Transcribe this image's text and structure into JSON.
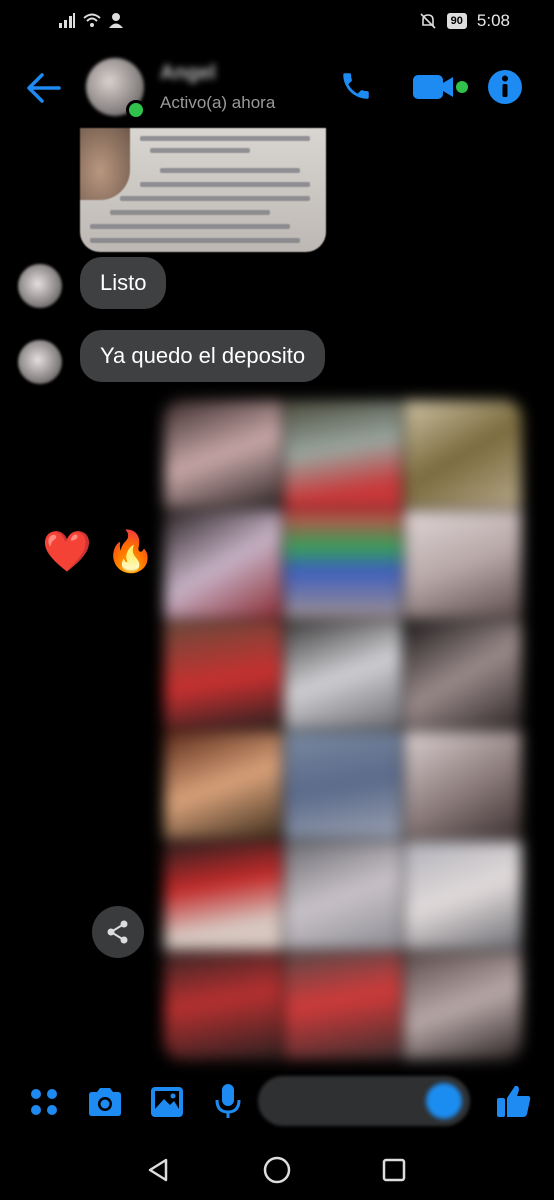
{
  "status_bar": {
    "time": "5:08",
    "battery": "90",
    "icons": [
      "signal-icon",
      "wifi-icon",
      "person-status-icon",
      "mute-bell-icon",
      "battery-icon"
    ]
  },
  "header": {
    "contact_name": "Angel",
    "status": "Activo(a) ahora",
    "accent_color": "#1d8bf1",
    "online_color": "#30c24b"
  },
  "messages": [
    {
      "type": "image",
      "content": "receipt-photo"
    },
    {
      "type": "text",
      "text": "Listo"
    },
    {
      "type": "text",
      "text": "Ya quedo el deposito"
    },
    {
      "type": "image-collage",
      "tile_count": 18
    }
  ],
  "reactions": [
    "❤️",
    "🔥"
  ],
  "composer": {
    "icons": [
      "menu-dots-icon",
      "camera-icon",
      "gallery-icon",
      "microphone-icon",
      "emoji-icon",
      "like-icon"
    ]
  },
  "navbar": {
    "icons": [
      "back-triangle-icon",
      "home-circle-icon",
      "recents-square-icon"
    ]
  }
}
